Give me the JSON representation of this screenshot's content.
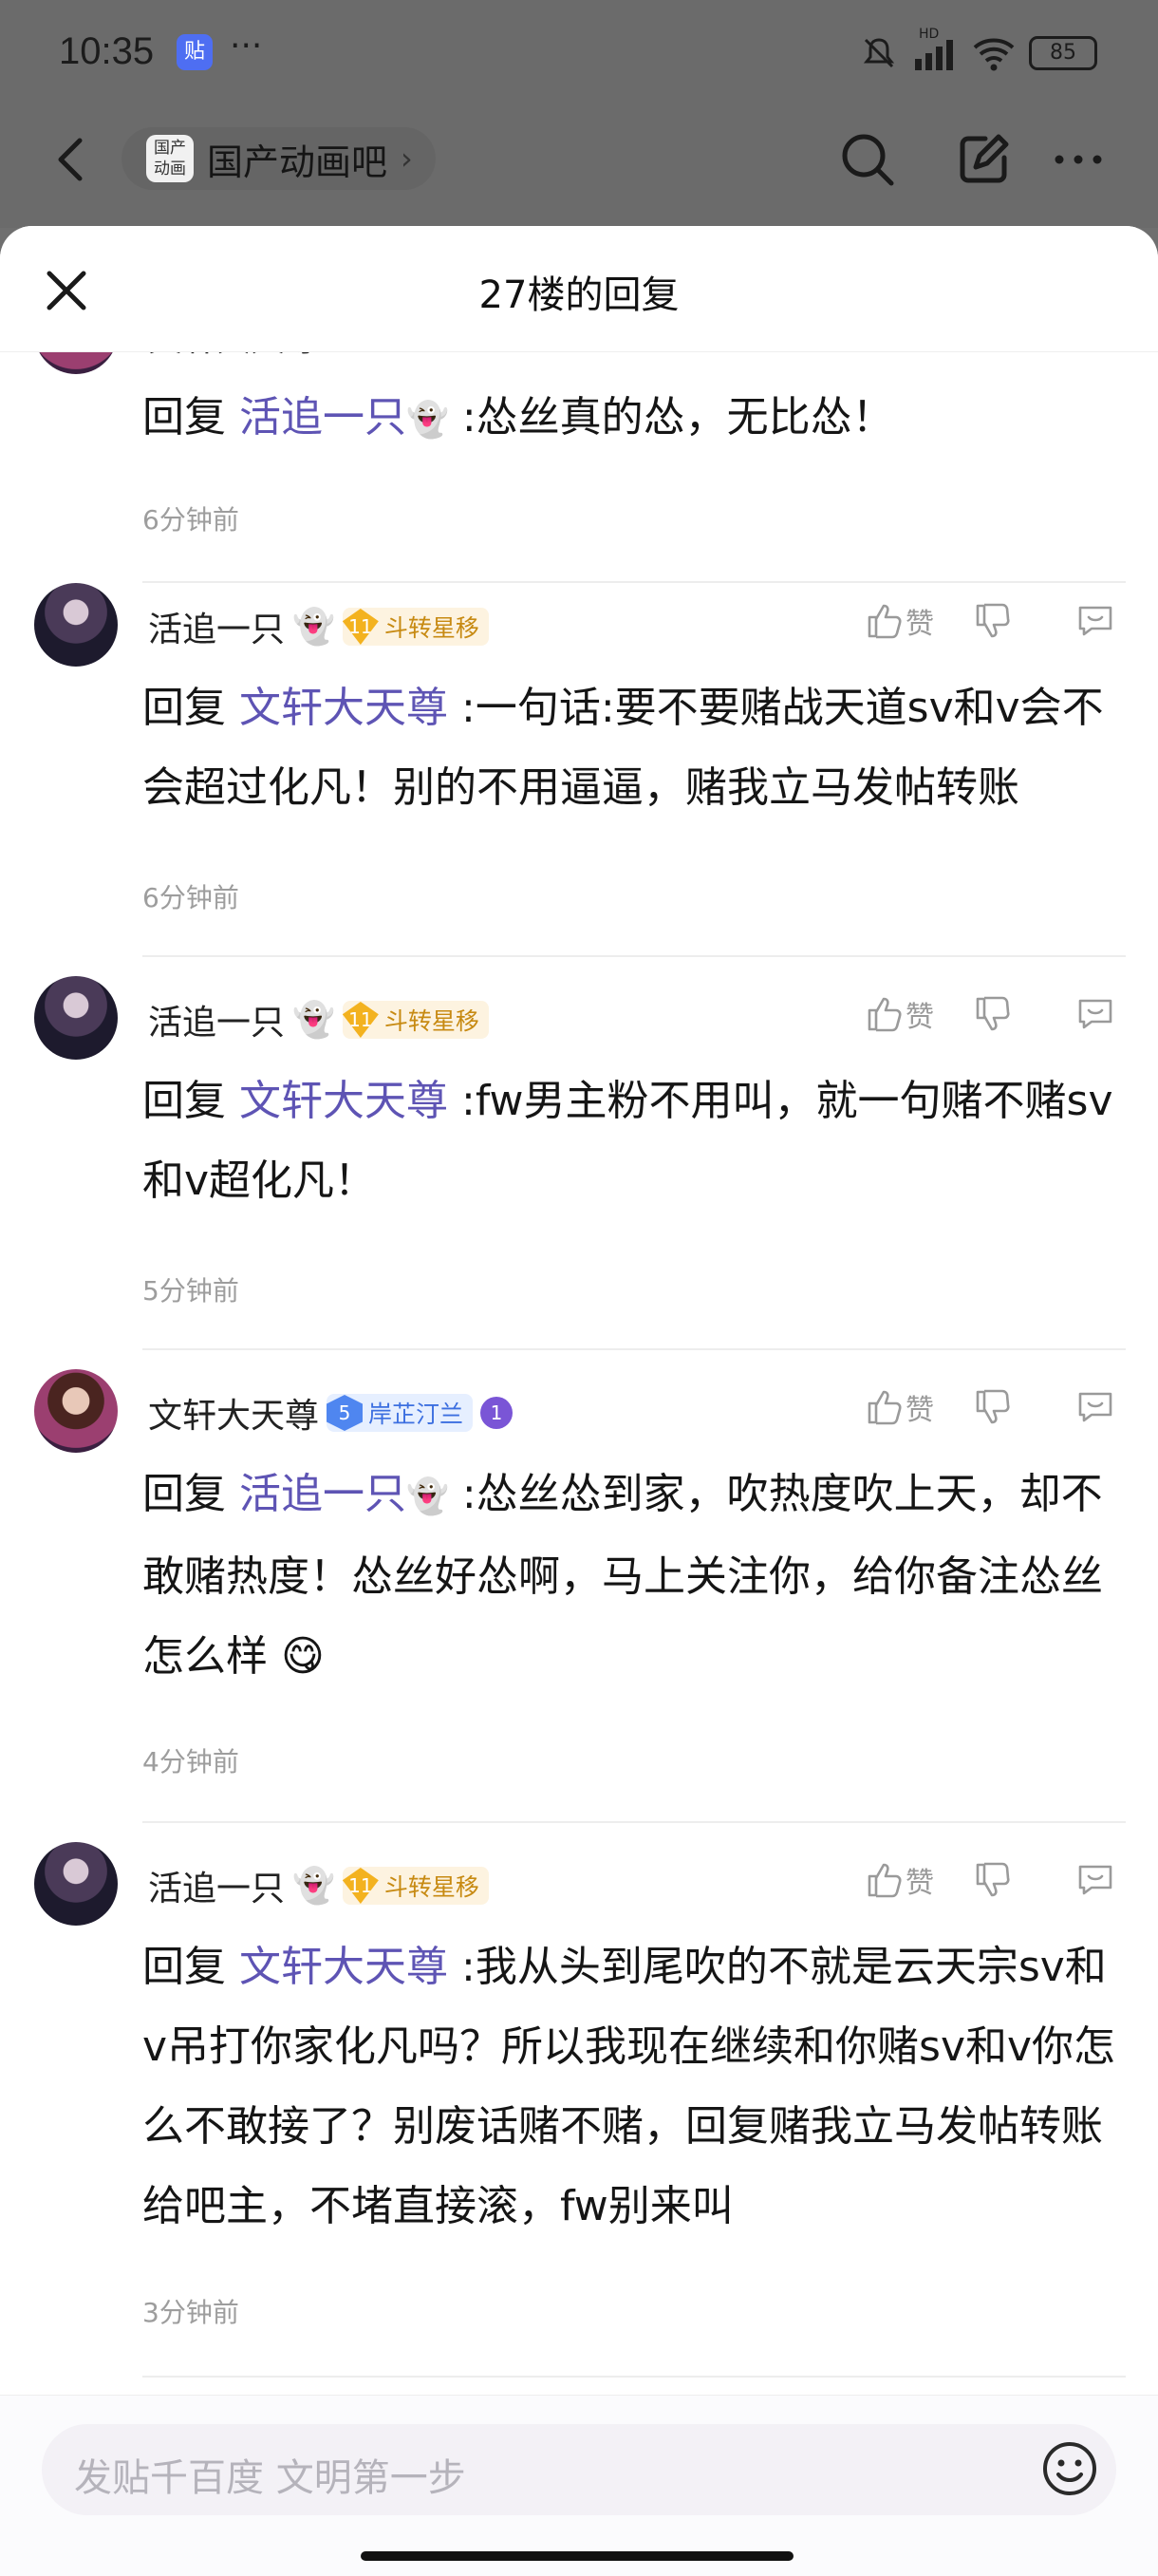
{
  "status_bar": {
    "time": "10:35",
    "app_badge": "贴",
    "dots": "···",
    "hd": "HD",
    "battery": "85"
  },
  "nav": {
    "forum_name": "国产动画吧",
    "forum_logo_text": "国产动画"
  },
  "sheet": {
    "title": "27楼的回复"
  },
  "reply_keyword": "回复",
  "actions": {
    "like_label": "赞"
  },
  "comments": [
    {
      "user": "文轩大天尊",
      "mention": "活追一只",
      "text": ":怂丝真的怂，无比怂！",
      "time": "6分钟前"
    },
    {
      "user": "活追一只",
      "ghost": "👻",
      "level": "11",
      "badge": "斗转星移",
      "mention": "文轩大天尊",
      "text": ":一句话:要不要赌战天道sv和v会不会超过化凡！别的不用逼逼，赌我立马发帖转账",
      "time": "6分钟前"
    },
    {
      "user": "活追一只",
      "ghost": "👻",
      "level": "11",
      "badge": "斗转星移",
      "mention": "文轩大天尊",
      "text": ":fw男主粉不用叫，就一句赌不赌sv和v超化凡！",
      "time": "5分钟前"
    },
    {
      "user": "文轩大天尊",
      "level": "5",
      "badge": "岸芷汀兰",
      "medal": "1",
      "mention": "活追一只",
      "mention_ghost": "👻",
      "text": ":怂丝怂到家，吹热度吹上天，却不敢赌热度！怂丝好怂啊，马上关注你，给你备注怂丝怎么样 😋",
      "time": "4分钟前"
    },
    {
      "user": "活追一只",
      "ghost": "👻",
      "level": "11",
      "badge": "斗转星移",
      "mention": "文轩大天尊",
      "text": ":我从头到尾吹的不就是云天宗sv和v吊打你家化凡吗？所以我现在继续和你赌sv和v你怎么不敢接了？别废话赌不赌，回复赌我立马发帖转账给吧主，不堵直接滚，fw别来叫",
      "time": "3分钟前"
    }
  ],
  "input": {
    "placeholder": "发贴千百度 文明第一步"
  },
  "colors": {
    "mention": "#5e54b4",
    "level_gold": "#f3b21f",
    "level_blue": "#4f86f0"
  }
}
